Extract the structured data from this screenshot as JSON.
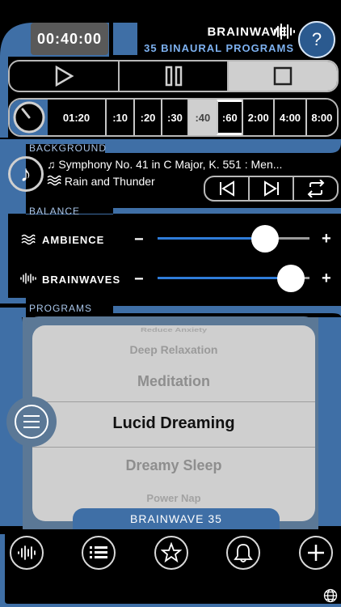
{
  "header": {
    "timer": "00:40:00",
    "brand": "BRAINWAVE",
    "subtitle": "35 BINAURAL PROGRAMS"
  },
  "duration_bar": {
    "presets": [
      ":10",
      ":20",
      ":30",
      ":40",
      ":60",
      "2:00",
      "4:00",
      "8:00"
    ],
    "current": "01:20",
    "selected": ":40",
    "active": ":60"
  },
  "sections": {
    "background": "BACKGROUND",
    "balance": "BALANCE",
    "programs": "PROGRAMS"
  },
  "background": {
    "track": "Symphony No. 41 in C Major, K. 551 : Men...",
    "ambience_track": "Rain and Thunder"
  },
  "balance": {
    "ambience_label": "AMBIENCE",
    "ambience_level": 0.75,
    "brainwaves_label": "BRAINWAVES",
    "brainwaves_level": 0.96
  },
  "programs": {
    "items": [
      "Reduce Anxiety",
      "Deep Relaxation",
      "Meditation",
      "Lucid Dreaming",
      "Dreamy Sleep",
      "Power Nap"
    ],
    "selected": "Lucid Dreaming",
    "footer": "BRAINWAVE 35"
  },
  "colors": {
    "accent": "#3f6fa6",
    "slider_fill": "#2f7cd9"
  }
}
